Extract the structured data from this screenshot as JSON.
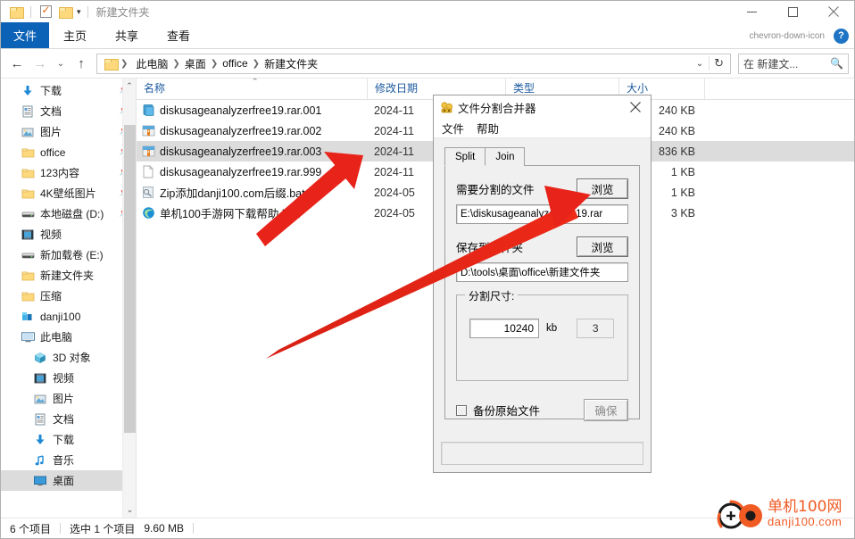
{
  "window": {
    "title": "新建文件夹",
    "quick_access": [
      "folder-icon",
      "properties-icon",
      "new-folder-icon",
      "customize-caret"
    ],
    "controls": {
      "minimize": "minimize-icon",
      "maximize": "maximize-icon",
      "close": "close-icon"
    }
  },
  "ribbon": {
    "tabs": [
      {
        "label": "文件",
        "active": true
      },
      {
        "label": "主页",
        "active": false
      },
      {
        "label": "共享",
        "active": false
      },
      {
        "label": "查看",
        "active": false
      }
    ],
    "collapse_caret": "chevron-down-icon",
    "help": "?"
  },
  "address": {
    "back": "←",
    "forward": "→",
    "recent": "⌄",
    "up": "↑",
    "crumbs": [
      "此电脑",
      "桌面",
      "office",
      "新建文件夹"
    ],
    "dropdown_caret": "⌄",
    "refresh": "↻"
  },
  "search": {
    "placeholder": "在 新建文...",
    "icon": "search-icon"
  },
  "sidebar": {
    "items": [
      {
        "label": "下载",
        "icon": "download-icon",
        "pinned": true,
        "indent": false,
        "selected": false
      },
      {
        "label": "文档",
        "icon": "documents-icon",
        "pinned": true,
        "indent": false,
        "selected": false
      },
      {
        "label": "图片",
        "icon": "pictures-icon",
        "pinned": true,
        "indent": false,
        "selected": false
      },
      {
        "label": "office",
        "icon": "folder-icon",
        "pinned": true,
        "indent": false,
        "selected": false
      },
      {
        "label": "123内容",
        "icon": "folder-icon",
        "pinned": true,
        "indent": false,
        "selected": false
      },
      {
        "label": "4K壁纸图片",
        "icon": "folder-icon",
        "pinned": true,
        "indent": false,
        "selected": false
      },
      {
        "label": "本地磁盘 (D:)",
        "icon": "drive-icon",
        "pinned": true,
        "indent": false,
        "selected": false
      },
      {
        "label": "视频",
        "icon": "videos-icon",
        "pinned": false,
        "indent": false,
        "selected": false
      },
      {
        "label": "新加载卷 (E:)",
        "icon": "drive-icon",
        "pinned": false,
        "indent": false,
        "selected": false
      },
      {
        "label": "新建文件夹",
        "icon": "folder-icon",
        "pinned": false,
        "indent": false,
        "selected": false
      },
      {
        "label": "压缩",
        "icon": "folder-icon",
        "pinned": false,
        "indent": false,
        "selected": false
      },
      {
        "label": "danji100",
        "icon": "onedrive-icon",
        "pinned": false,
        "indent": false,
        "selected": false
      },
      {
        "label": "此电脑",
        "icon": "this-pc-icon",
        "pinned": false,
        "indent": false,
        "selected": false
      },
      {
        "label": "3D 对象",
        "icon": "3d-objects-icon",
        "pinned": false,
        "indent": true,
        "selected": false
      },
      {
        "label": "视频",
        "icon": "videos-icon",
        "pinned": false,
        "indent": true,
        "selected": false
      },
      {
        "label": "图片",
        "icon": "pictures-icon",
        "pinned": false,
        "indent": true,
        "selected": false
      },
      {
        "label": "文档",
        "icon": "documents-icon",
        "pinned": false,
        "indent": true,
        "selected": false
      },
      {
        "label": "下载",
        "icon": "download-icon",
        "pinned": false,
        "indent": true,
        "selected": false
      },
      {
        "label": "音乐",
        "icon": "music-icon",
        "pinned": false,
        "indent": true,
        "selected": false
      },
      {
        "label": "桌面",
        "icon": "desktop-icon",
        "pinned": false,
        "indent": true,
        "selected": true
      }
    ]
  },
  "filelist": {
    "columns": [
      {
        "label": "名称",
        "sorted": true
      },
      {
        "label": "修改日期",
        "sorted": false
      },
      {
        "label": "类型",
        "sorted": false
      },
      {
        "label": "大小",
        "sorted": false
      }
    ],
    "rows": [
      {
        "name": "diskusageanalyzerfree19.rar.001",
        "date": "2024-11",
        "type": "",
        "size": "240 KB",
        "icon": "winrar-part-icon",
        "selected": false
      },
      {
        "name": "diskusageanalyzerfree19.rar.002",
        "date": "2024-11",
        "type": "",
        "size": "240 KB",
        "icon": "archive-part-icon",
        "selected": false
      },
      {
        "name": "diskusageanalyzerfree19.rar.003",
        "date": "2024-11",
        "type": "",
        "size": "836 KB",
        "icon": "archive-part-icon",
        "selected": true
      },
      {
        "name": "diskusageanalyzerfree19.rar.999",
        "date": "2024-11",
        "type": "",
        "size": "1 KB",
        "icon": "blank-file-icon",
        "selected": false
      },
      {
        "name": "Zip添加danji100.com后缀.bat",
        "date": "2024-05",
        "type": "",
        "size": "1 KB",
        "icon": "bat-file-icon",
        "selected": false
      },
      {
        "name": "单机100手游网下载帮助.htm",
        "date": "2024-05",
        "type": "",
        "size": "3 KB",
        "icon": "edge-html-icon",
        "selected": false
      }
    ]
  },
  "status": {
    "item_count": "6 个项目",
    "selection": "选中 1 个项目",
    "selection_size": "9.60 MB"
  },
  "dialog": {
    "title": "文件分割合并器",
    "icon": "splitter-app-icon",
    "close": "close-icon",
    "menu": [
      "文件",
      "帮助"
    ],
    "tabs": [
      {
        "label": "Split",
        "active": true
      },
      {
        "label": "Join",
        "active": false
      }
    ],
    "source_label": "需要分割的文件",
    "source_browse": "浏览",
    "source_value": "E:\\diskusageanalyzerfree19.rar",
    "dest_label": "保存到文件夹",
    "dest_browse": "浏览",
    "dest_value": "D:\\tools\\桌面\\office\\新建文件夹",
    "group_title": "分割尺寸:",
    "size_value": "10240",
    "size_unit": "kb",
    "parts_value": "3",
    "backup_label": "备份原始文件",
    "backup_checked": false,
    "confirm_label": "确保"
  },
  "watermark": {
    "line1": "单机100网",
    "line2": "danji100.com"
  },
  "colors": {
    "accent": "#0b62b6",
    "header_link": "#1b5a9e",
    "selection": "#dcdcdc",
    "arrow": "#e8231a",
    "watermark": "#f05a23",
    "folder": "#fdd87d"
  }
}
